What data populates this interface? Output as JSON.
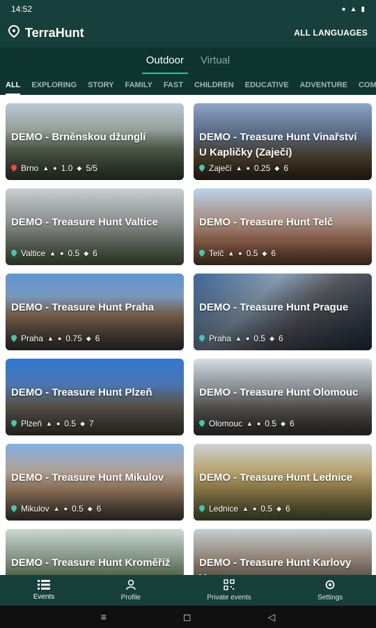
{
  "status": {
    "time": "14:52"
  },
  "app": {
    "name": "TerraHunt",
    "languages": "ALL LANGUAGES"
  },
  "modes": [
    {
      "label": "Outdoor"
    },
    {
      "label": "Virtual"
    }
  ],
  "categories": [
    "ALL",
    "EXPLORING",
    "STORY",
    "FAMILY",
    "FAST",
    "CHILDREN",
    "EDUCATIVE",
    "ADVENTURE",
    "COM"
  ],
  "cards": [
    {
      "title": "DEMO - Brněnskou džunglí",
      "place": "Brno",
      "distance": "1.0",
      "rating": "5/5",
      "pin_color": "#e74b4b",
      "bg": "linear-gradient(180deg,#b9cad6 0%,#b7c4bf 35%,#6e7f66 60%,#3d4a36 100%)"
    },
    {
      "title": "DEMO - Treasure Hunt Vinařství U Kapličky (Zaječí)",
      "place": "Zaječí",
      "distance": "0.25",
      "rating": "6",
      "pin_color": "#45c7b0",
      "bg": "linear-gradient(180deg,#8ea6c7 0%,#6f86a8 40%,#6b5b3e 70%,#3a2e1f 100%)"
    },
    {
      "title": "DEMO - Treasure Hunt Valtice",
      "place": "Valtice",
      "distance": "0.5",
      "rating": "6",
      "pin_color": "#45c7b0",
      "bg": "linear-gradient(180deg,#c8d0d2 0%,#b4bbb9 45%,#8e9a8a 70%,#5a6d48 100%)"
    },
    {
      "title": "DEMO - Treasure Hunt Telč",
      "place": "Telč",
      "distance": "0.5",
      "rating": "6",
      "pin_color": "#45c7b0",
      "bg": "linear-gradient(180deg,#b9d3ee 0%,#d8b6a1 45%,#c8866a 70%,#6f4a36 100%)"
    },
    {
      "title": "DEMO - Treasure Hunt Praha",
      "place": "Praha",
      "distance": "0.75",
      "rating": "6",
      "pin_color": "#45c7b0",
      "bg": "linear-gradient(180deg,#5f93d4 0%,#8fb5e0 30%,#a47f63 55%,#3b3f3c 100%)"
    },
    {
      "title": "DEMO - Treasure Hunt Prague",
      "place": "Praha",
      "distance": "0.5",
      "rating": "6",
      "pin_color": "#45c7b0",
      "bg": "linear-gradient(135deg,#3f6a9a 0%,#8aa0b6 35%,#595b61 60%,#23354a 100%)"
    },
    {
      "title": "DEMO - Treasure Hunt Plzeň",
      "place": "Plzeň",
      "distance": "0.5",
      "rating": "7",
      "pin_color": "#45c7b0",
      "bg": "linear-gradient(180deg,#2f78d0 0%,#5b91d8 35%,#807a6f 60%,#4b4943 100%)"
    },
    {
      "title": "DEMO - Treasure Hunt Olomouc",
      "place": "Olomouc",
      "distance": "0.5",
      "rating": "6",
      "pin_color": "#45c7b0",
      "bg": "linear-gradient(180deg,#d8dfe6 0%,#a9b1b5 40%,#76746f 65%,#3f3e3c 100%)"
    },
    {
      "title": "DEMO - Treasure Hunt Mikulov",
      "place": "Mikulov",
      "distance": "0.5",
      "rating": "6",
      "pin_color": "#45c7b0",
      "bg": "linear-gradient(180deg,#7fb1e8 0%,#d6c7b8 35%,#c9a07c 60%,#4f4a3e 100%)"
    },
    {
      "title": "DEMO - Treasure Hunt Lednice",
      "place": "Lednice",
      "distance": "0.5",
      "rating": "6",
      "pin_color": "#45c7b0",
      "bg": "linear-gradient(180deg,#cbd4d8 0%,#e2c98c 35%,#c4a863 60%,#5b6a3a 100%)"
    },
    {
      "title": "DEMO - Treasure Hunt Kroměříž",
      "place": "",
      "distance": "",
      "rating": "",
      "pin_color": "#45c7b0",
      "bg": "linear-gradient(180deg,#cfd9d4 0%,#a2b8a3 40%,#6d8c57 70%,#3a4f2e 100%)"
    },
    {
      "title": "DEMO - Treasure Hunt Karlovy Vary",
      "place": "",
      "distance": "",
      "rating": "",
      "pin_color": "#45c7b0",
      "bg": "linear-gradient(180deg,#c5d2d8 0%,#b8a99a 35%,#8d7a6a 65%,#5d5248 100%)"
    }
  ],
  "nav": [
    {
      "label": "Events",
      "icon": "list-icon"
    },
    {
      "label": "Profile",
      "icon": "person-icon"
    },
    {
      "label": "Private events",
      "icon": "qr-icon"
    },
    {
      "label": "Settings",
      "icon": "gear-icon"
    }
  ]
}
